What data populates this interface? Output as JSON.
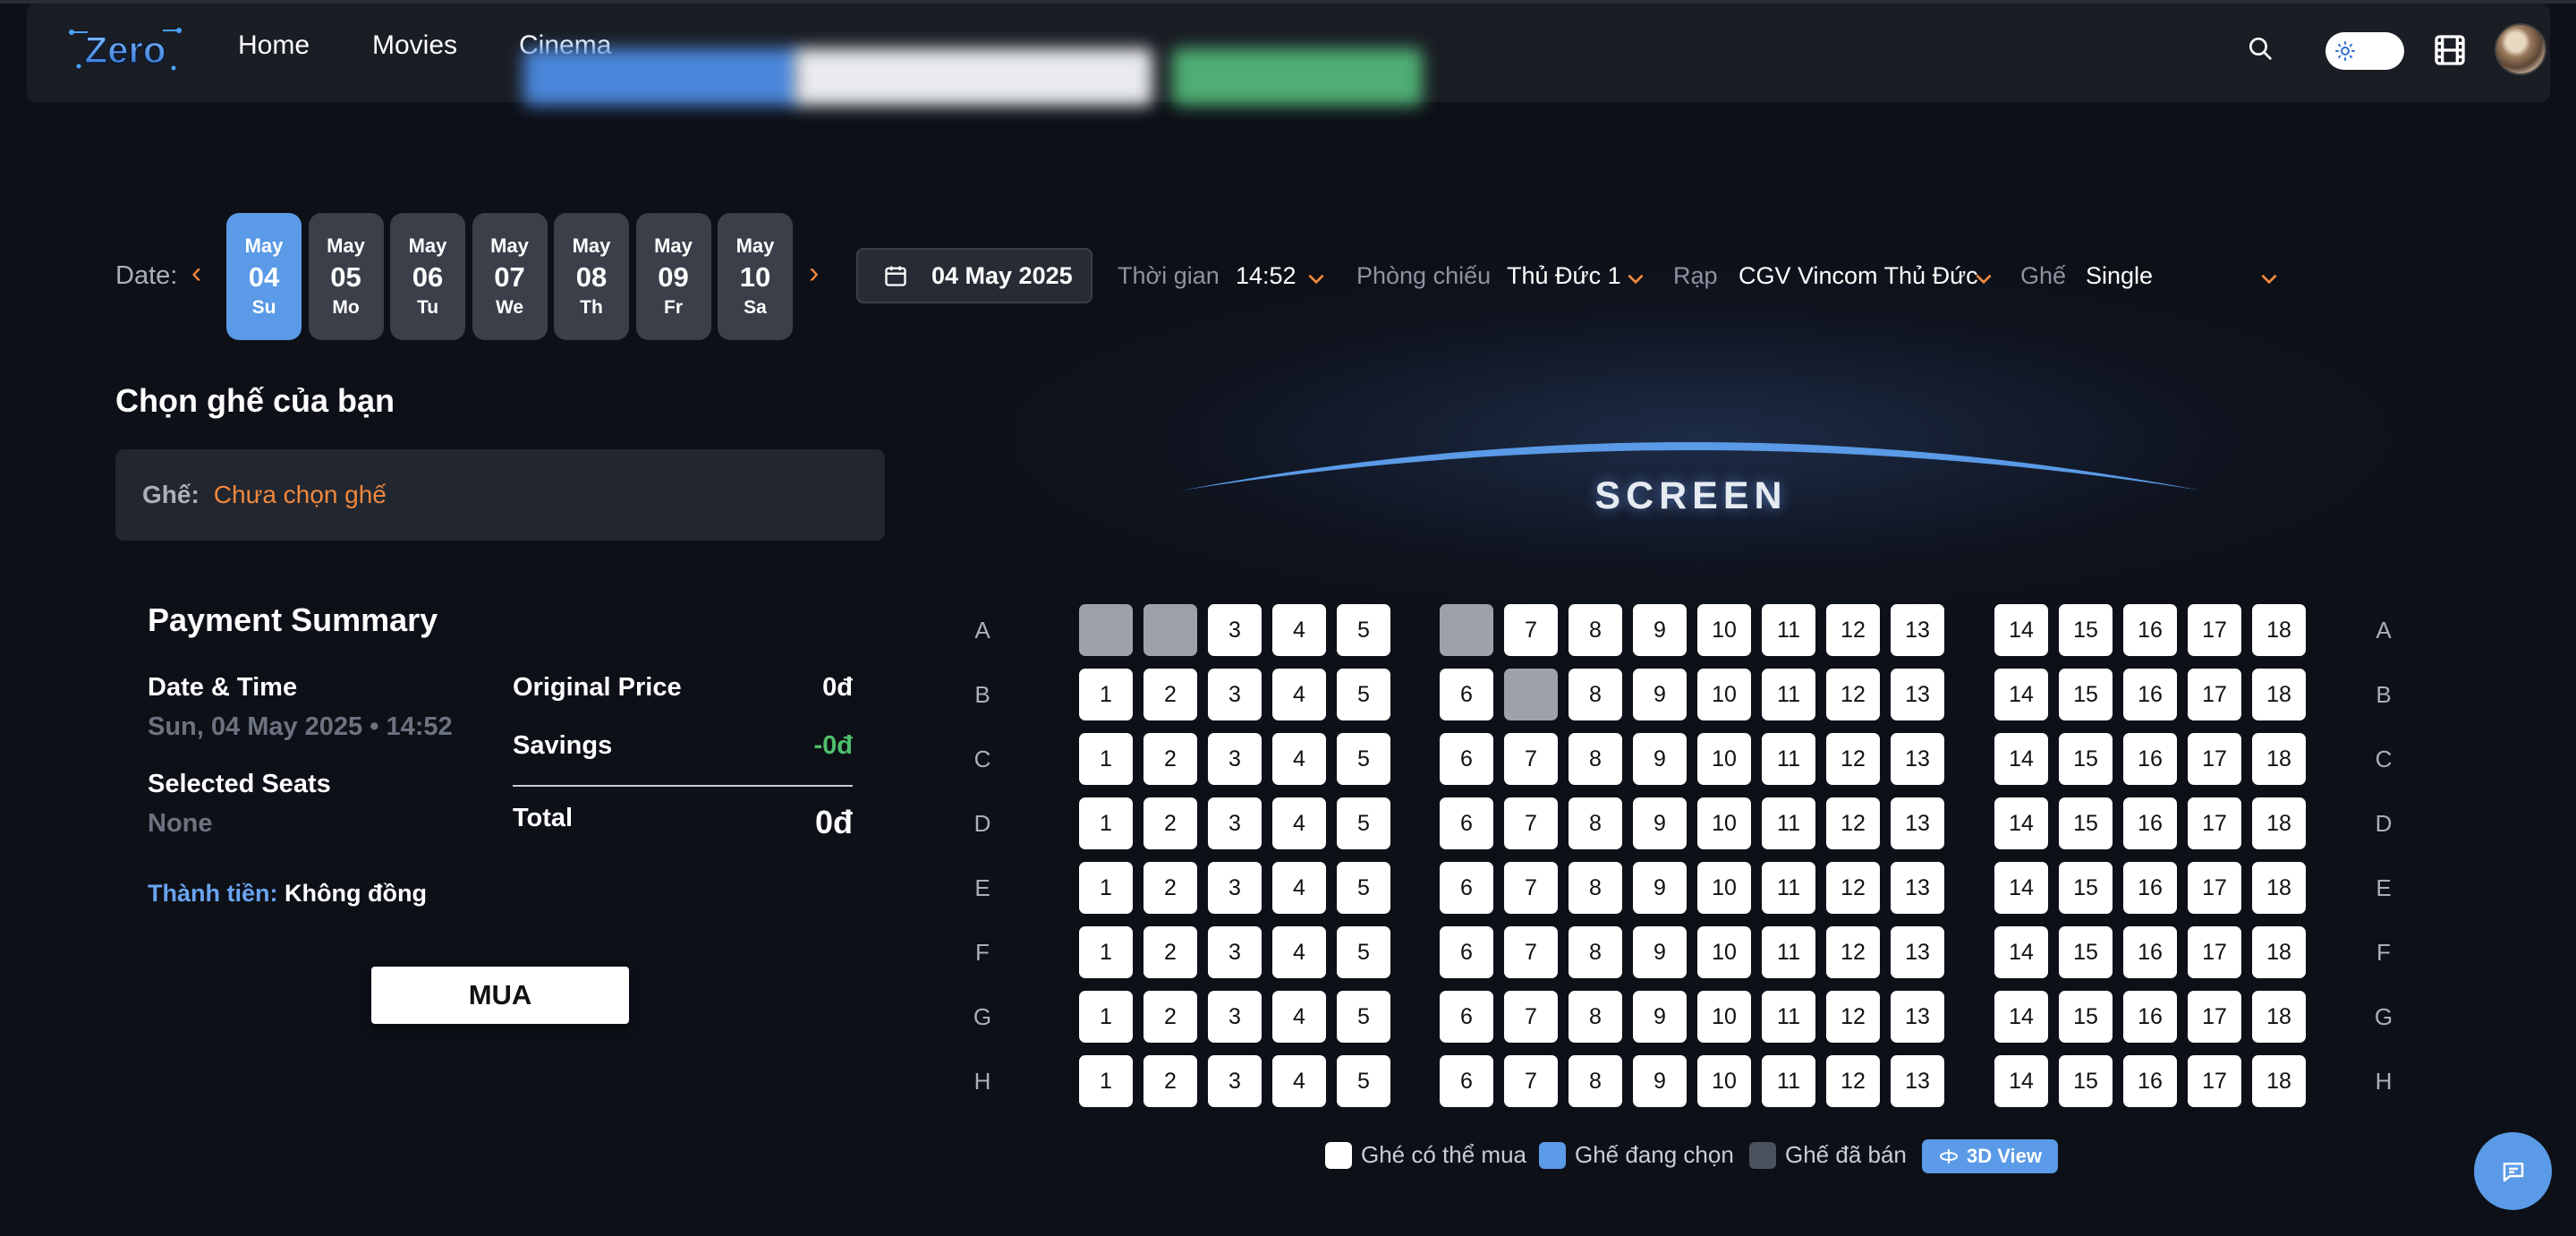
{
  "nav": {
    "brand": "Zero",
    "links": [
      "Home",
      "Movies",
      "Cinema"
    ]
  },
  "date": {
    "label": "Date:",
    "days": [
      {
        "mon": "May",
        "num": "04",
        "wd": "Su",
        "active": true
      },
      {
        "mon": "May",
        "num": "05",
        "wd": "Mo"
      },
      {
        "mon": "May",
        "num": "06",
        "wd": "Tu"
      },
      {
        "mon": "May",
        "num": "07",
        "wd": "We"
      },
      {
        "mon": "May",
        "num": "08",
        "wd": "Th"
      },
      {
        "mon": "May",
        "num": "09",
        "wd": "Fr"
      },
      {
        "mon": "May",
        "num": "10",
        "wd": "Sa"
      }
    ],
    "picker_value": "04 May 2025"
  },
  "filters": {
    "time_label": "Thời gian",
    "time_value": "14:52",
    "room_label": "Phòng chiếu",
    "room_value": "Thủ Đức 1",
    "cinema_label": "Rạp",
    "cinema_value": "CGV Vincom Thủ Đức",
    "seat_label": "Ghế",
    "seat_value": "Single"
  },
  "seat_section": {
    "title": "Chọn ghế của bạn",
    "seat_key": "Ghế:",
    "seat_value": "Chưa chọn ghế"
  },
  "payment": {
    "title": "Payment Summary",
    "datetime_label": "Date & Time",
    "datetime_value": "Sun, 04 May 2025 • 14:52",
    "seats_label": "Selected Seats",
    "seats_value": "None",
    "original_label": "Original Price",
    "original_value": "0đ",
    "savings_label": "Savings",
    "savings_value": "-0đ",
    "total_label": "Total",
    "total_value": "0đ",
    "final_label": "Thành tiền:",
    "final_value": "Không đồng",
    "buy_label": "MUA"
  },
  "screen": {
    "label": "SCREEN"
  },
  "rows": [
    "A",
    "B",
    "C",
    "D",
    "E",
    "F",
    "G",
    "H"
  ],
  "seat_groups": [
    [
      1,
      2,
      3,
      4,
      5
    ],
    [
      6,
      7,
      8,
      9,
      10,
      11,
      12,
      13
    ],
    [
      14,
      15,
      16,
      17,
      18
    ]
  ],
  "sold_seats": [
    "A1",
    "A2",
    "A6",
    "B7"
  ],
  "legend": {
    "available": "Ghé có thể mua",
    "selected": "Ghế đang chọn",
    "sold": "Ghế đã bán",
    "view3d": "3D View"
  },
  "colors": {
    "accent": "#5a9ae6",
    "orange": "#f0883e",
    "green": "#4fbf6a",
    "available": "#ffffff",
    "sold_seat": "#9ea2a8",
    "sold_legend": "#4b515c"
  },
  "icons": [
    "search-icon",
    "sun-icon",
    "film-icon",
    "calendar-icon",
    "chevron-down-icon",
    "chat-icon",
    "rotate-3d-icon"
  ]
}
